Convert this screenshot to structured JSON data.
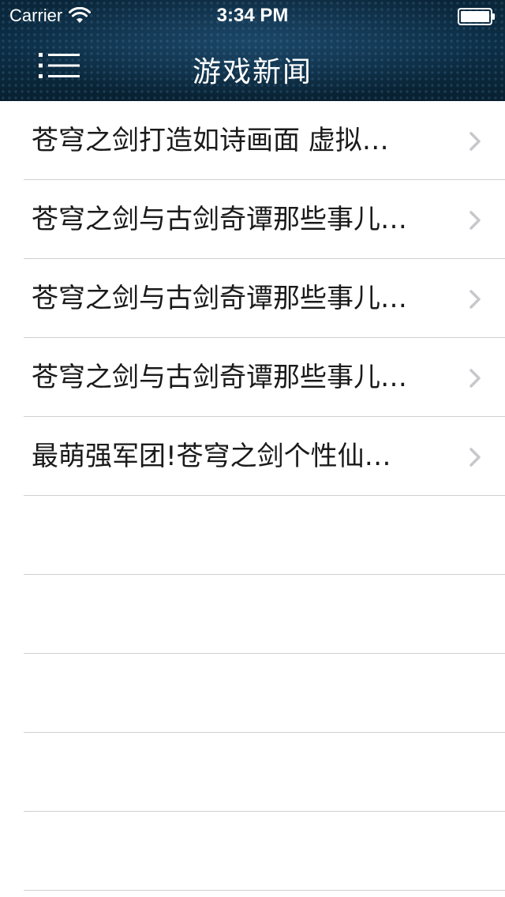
{
  "status_bar": {
    "carrier": "Carrier",
    "time": "3:34 PM"
  },
  "nav": {
    "title": "游戏新闻",
    "menu_icon": "list-menu-icon"
  },
  "news": [
    {
      "title": "苍穹之剑打造如诗画面 虚拟…"
    },
    {
      "title": "苍穹之剑与古剑奇谭那些事儿…"
    },
    {
      "title": "苍穹之剑与古剑奇谭那些事儿…"
    },
    {
      "title": "苍穹之剑与古剑奇谭那些事儿…"
    },
    {
      "title": "最萌强军团!苍穹之剑个性仙…"
    }
  ],
  "empty_rows": 5,
  "colors": {
    "header_bg": "#0c2f47",
    "separator": "#cfcfd3",
    "chevron": "#c7c7cc",
    "text": "#1a1a1a"
  }
}
